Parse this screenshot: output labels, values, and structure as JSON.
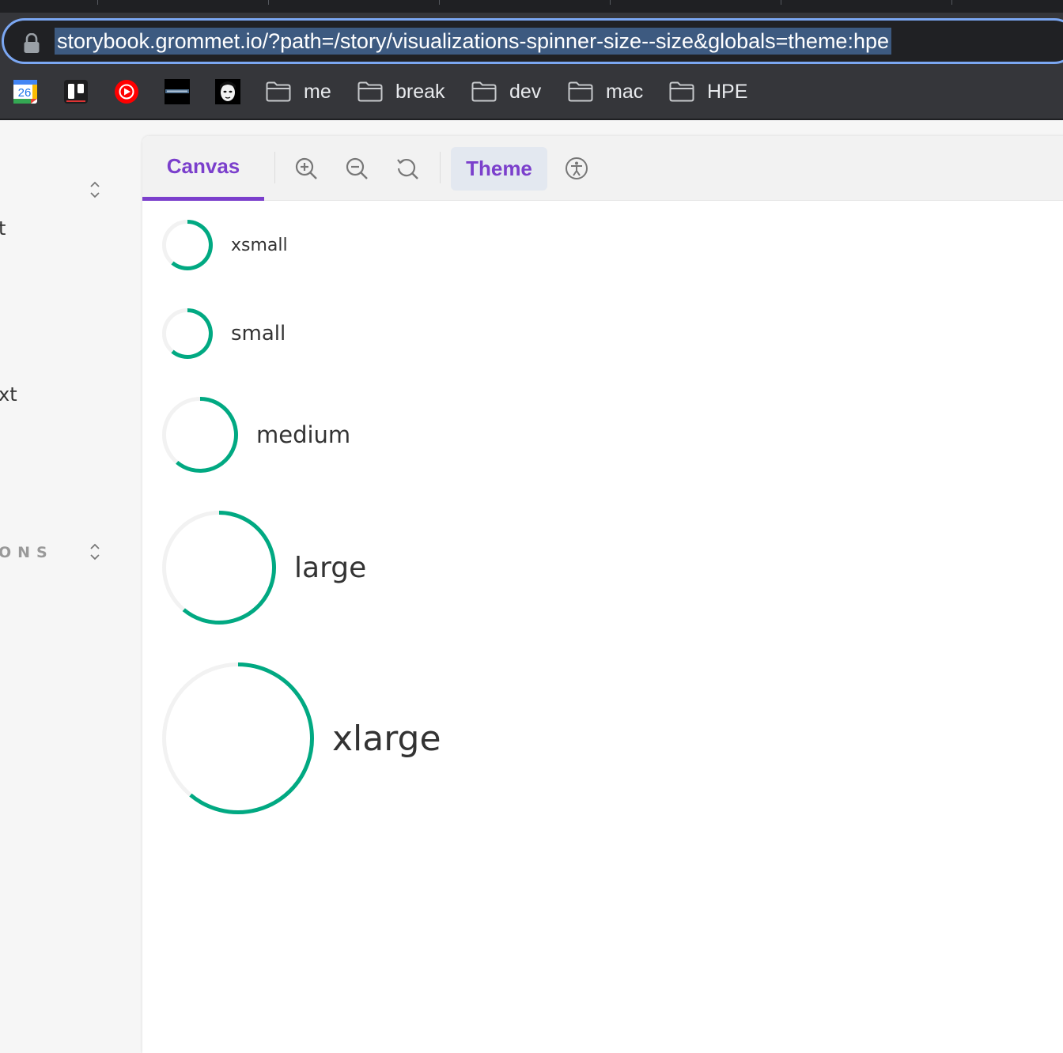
{
  "browser": {
    "url": "storybook.grommet.io/?path=/story/visualizations-spinner-size--size&globals=theme:hpe",
    "bookmarks": {
      "calendar_day": "26",
      "folders": [
        "me",
        "break",
        "dev",
        "mac",
        "HPE"
      ]
    }
  },
  "sidebar": {
    "fragment_1": "t",
    "fragment_2": "xt",
    "section_label": "ONS"
  },
  "toolbar": {
    "canvas_tab": "Canvas",
    "theme_button": "Theme",
    "icons": [
      "zoom-in-icon",
      "zoom-out-icon",
      "reset-zoom-icon",
      "accessibility-icon"
    ]
  },
  "spinners": [
    {
      "size": "xsmall"
    },
    {
      "size": "small"
    },
    {
      "size": "medium"
    },
    {
      "size": "large"
    },
    {
      "size": "xlarge"
    }
  ],
  "colors": {
    "spinner_accent": "#01a982",
    "spinner_track": "#f2f2f2",
    "active_tab": "#7b3fcc",
    "url_highlight": "#3d5a80"
  }
}
